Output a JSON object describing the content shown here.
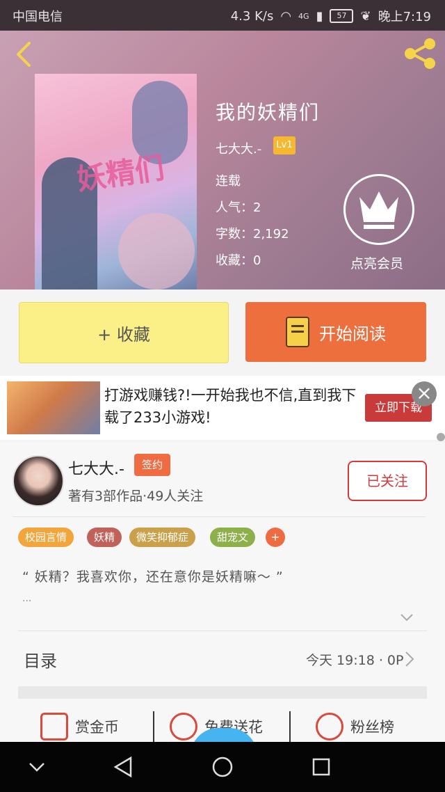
{
  "status_bar": {
    "carrier": "中国电信",
    "speed": "4.3 K/s",
    "network": "4G",
    "battery": "57",
    "time": "晚上7:19"
  },
  "book": {
    "title": "我的妖精们",
    "author": "七大大.-",
    "author_level": "Lv1",
    "status": "连载",
    "popularity": "人气：2",
    "word_count": "字数：2,192",
    "favorites": "收藏：0",
    "cover_text": "妖精们",
    "vip_label": "点亮会员"
  },
  "actions": {
    "collect_label": "+ 收藏",
    "read_label": "开始阅读"
  },
  "ad": {
    "text": "打游戏赚钱?!一开始我也不信,直到我下载了233小游戏!",
    "button": "立即下载",
    "close": "×"
  },
  "author": {
    "name": "七大大.-",
    "badge": "签约",
    "stats": "著有3部作品·49人关注",
    "follow_label": "已关注",
    "tags": [
      "校园言情",
      "妖精",
      "微笑抑郁症",
      "甜宠文"
    ],
    "more_tags": "+"
  },
  "intro": {
    "text": "“ 妖精？我喜欢你，还在意你是妖精嘛～ ”",
    "more": "..."
  },
  "toc": {
    "label": "目录",
    "update": "今天 19:18 · 0P"
  },
  "bottom_tabs": [
    "赏金币",
    "免费送花",
    "粉丝榜"
  ],
  "colors": {
    "accent_orange": "#ee6f3e",
    "collect_yellow": "#fbf088",
    "follow_red": "#d43a3a"
  }
}
